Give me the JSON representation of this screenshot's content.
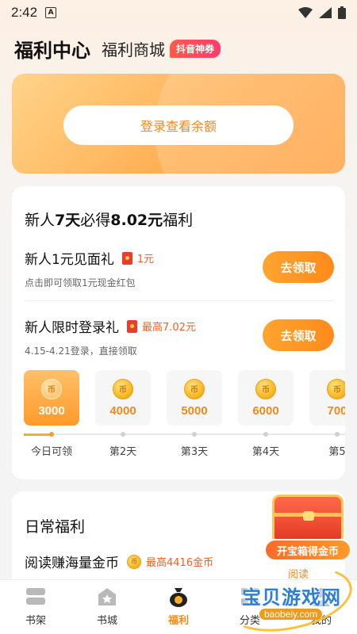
{
  "status_bar": {
    "time": "2:42",
    "notification_letter": "A"
  },
  "header": {
    "title": "福利中心",
    "tab_mall": "福利商城",
    "badge": "抖音神券"
  },
  "balance_card": {
    "login_label": "登录查看余额"
  },
  "newbie": {
    "title_prefix": "新人",
    "title_bold": "7天",
    "title_mid": "必得",
    "title_amount": "8.02元",
    "title_suffix": "福利",
    "tasks": [
      {
        "name": "新人1元见面礼",
        "reward": "1元",
        "desc": "点击即可领取1元现金红包",
        "button": "去领取"
      },
      {
        "name": "新人限时登录礼",
        "reward": "最高7.02元",
        "desc": "4.15-4.21登录，直接领取",
        "button": "去领取"
      }
    ],
    "days": [
      {
        "coin": "币",
        "amount": "3000",
        "label": "今日可领"
      },
      {
        "coin": "币",
        "amount": "4000",
        "label": "第2天"
      },
      {
        "coin": "币",
        "amount": "5000",
        "label": "第3天"
      },
      {
        "coin": "币",
        "amount": "6000",
        "label": "第4天"
      },
      {
        "coin": "币",
        "amount": "700",
        "label": "第5"
      }
    ]
  },
  "daily": {
    "title": "日常福利",
    "task_name": "阅读赚海量金币",
    "task_reward": "最高4416金币"
  },
  "promo": {
    "button": "开宝箱得金币",
    "sub": "阅读"
  },
  "bottom_nav": [
    {
      "label": "书架",
      "icon": "bookshelf-icon"
    },
    {
      "label": "书城",
      "icon": "bookstore-icon"
    },
    {
      "label": "福利",
      "icon": "welfare-bag-icon"
    },
    {
      "label": "分类",
      "icon": "category-icon"
    },
    {
      "label": "我的",
      "icon": "profile-icon"
    }
  ],
  "watermark": {
    "text": "宝贝游戏网",
    "url": "baobeiy.com"
  },
  "colors": {
    "accent": "#f08a1e",
    "button": "#ff8a1a",
    "reward_red": "#f3601f"
  }
}
